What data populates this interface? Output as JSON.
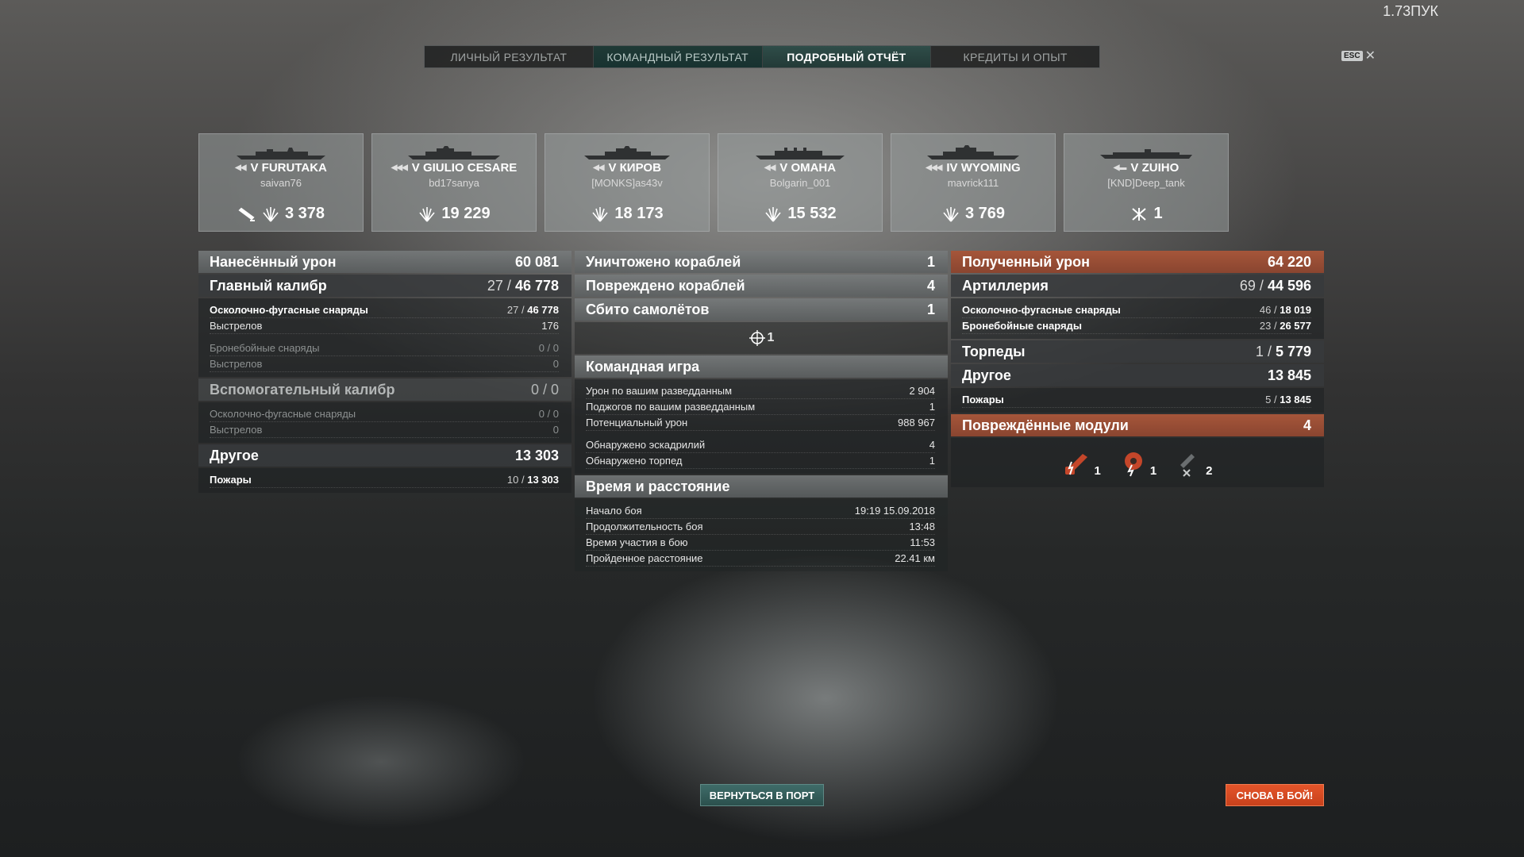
{
  "version": "1.73ПУК",
  "tabs": [
    {
      "label": "ЛИЧНЫЙ РЕЗУЛЬТАТ"
    },
    {
      "label": "КОМАНДНЫЙ РЕЗУЛЬТАТ"
    },
    {
      "label": "ПОДРОБНЫЙ ОТЧЁТ"
    },
    {
      "label": "КРЕДИТЫ И ОПЫТ"
    }
  ],
  "esc_label": "ESC",
  "ships": [
    {
      "tier_name": "V FURUTAKA",
      "player": "saivan76",
      "stat": "3 378"
    },
    {
      "tier_name": "V GIULIO CESARE",
      "player": "bd17sanya",
      "stat": "19 229"
    },
    {
      "tier_name": "V КИРОВ",
      "player": "[MONKS]as43v",
      "stat": "18 173"
    },
    {
      "tier_name": "V OMAHA",
      "player": "Bolgarin_001",
      "stat": "15 532"
    },
    {
      "tier_name": "IV WYOMING",
      "player": "mavrick111",
      "stat": "3 769"
    },
    {
      "tier_name": "V ZUIHO",
      "player": "[KND]Deep_tank",
      "stat": "1"
    }
  ],
  "damage": {
    "title": "Нанесённый урон",
    "total": "60 081",
    "main": {
      "title": "Главный калибр",
      "hits": "27",
      "dmg": "46 778"
    },
    "main_rows": [
      {
        "label": "Осколочно-фугасные снаряды",
        "a": "27",
        "b": "46 778"
      },
      {
        "label": "Выстрелов",
        "value": "176"
      },
      {
        "label": "Бронебойные снаряды",
        "a": "0",
        "b": "0"
      },
      {
        "label": "Выстрелов",
        "value": "0"
      }
    ],
    "secondary": {
      "title": "Вспомогательный калибр",
      "hits": "0",
      "dmg": "0"
    },
    "secondary_rows": [
      {
        "label": "Осколочно-фугасные снаряды",
        "a": "0",
        "b": "0"
      },
      {
        "label": "Выстрелов",
        "value": "0"
      }
    ],
    "other": {
      "title": "Другое",
      "total": "13 303"
    },
    "other_rows": [
      {
        "label": "Пожары",
        "a": "10",
        "b": "13 303"
      }
    ]
  },
  "center": {
    "destroyed": {
      "label": "Уничтожено кораблей",
      "value": "1"
    },
    "damaged": {
      "label": "Повреждено кораблей",
      "value": "4"
    },
    "planes": {
      "label": "Сбито самолётов",
      "value": "1"
    },
    "planes_icon_count": "1",
    "team_title": "Командная игра",
    "team_rows": [
      {
        "label": "Урон по вашим разведданным",
        "value": "2 904"
      },
      {
        "label": "Поджогов по вашим разведданным",
        "value": "1"
      },
      {
        "label": "Потенциальный урон",
        "value": "988 967"
      },
      {
        "label": "Обнаружено эскадрилий",
        "value": "4"
      },
      {
        "label": "Обнаружено торпед",
        "value": "1"
      }
    ],
    "time_title": "Время и расстояние",
    "time_rows": [
      {
        "label": "Начало боя",
        "value": "19:19  15.09.2018"
      },
      {
        "label": "Продолжительность боя",
        "value": "13:48"
      },
      {
        "label": "Время участия в бою",
        "value": "11:53"
      },
      {
        "label": "Пройденное расстояние",
        "value": "22.41 км"
      }
    ]
  },
  "received": {
    "title": "Полученный урон",
    "total": "64 220",
    "artillery": {
      "title": "Артиллерия",
      "hits": "69",
      "dmg": "44 596"
    },
    "artillery_rows": [
      {
        "label": "Осколочно-фугасные снаряды",
        "a": "46",
        "b": "18 019"
      },
      {
        "label": "Бронебойные снаряды",
        "a": "23",
        "b": "26 577"
      }
    ],
    "torpedoes": {
      "title": "Торпеды",
      "hits": "1",
      "dmg": "5 779"
    },
    "other": {
      "title": "Другое",
      "total": "13 845"
    },
    "other_rows": [
      {
        "label": "Пожары",
        "a": "5",
        "b": "13 845"
      }
    ],
    "modules": {
      "title": "Повреждённые модули",
      "total": "4"
    },
    "module_icons": [
      {
        "icon": "gun-damaged-icon",
        "count": "1"
      },
      {
        "icon": "engine-damaged-icon",
        "count": "1"
      },
      {
        "icon": "torpedo-tube-destroyed-icon",
        "count": "2"
      }
    ]
  },
  "buttons": {
    "port": "ВЕРНУТЬСЯ В ПОРТ",
    "battle": "СНОВА В БОЙ!"
  },
  "colors": {
    "accent_orange": "#e4552a",
    "team_teal": "#2b504d",
    "received_header": "#a6563a"
  }
}
